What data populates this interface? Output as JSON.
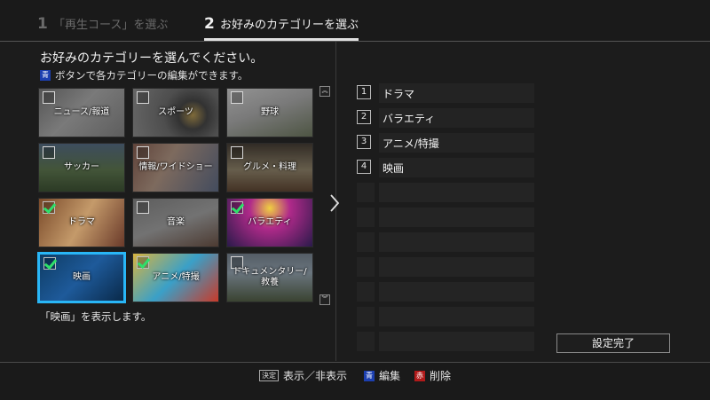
{
  "steps": [
    {
      "num": "1",
      "label": "「再生コース」を選ぶ"
    },
    {
      "num": "2",
      "label": "お好みのカテゴリーを選ぶ"
    }
  ],
  "heading": "お好みのカテゴリーを選んでください。",
  "hint": {
    "key": "青",
    "text": "ボタンで各カテゴリーの編集ができます。"
  },
  "categories": [
    {
      "label": "ニュース/報道",
      "checked": false
    },
    {
      "label": "スポーツ",
      "checked": false
    },
    {
      "label": "野球",
      "checked": false
    },
    {
      "label": "サッカー",
      "checked": false
    },
    {
      "label": "情報/ワイドショー",
      "checked": false
    },
    {
      "label": "グルメ・料理",
      "checked": false
    },
    {
      "label": "ドラマ",
      "checked": true
    },
    {
      "label": "音楽",
      "checked": false
    },
    {
      "label": "バラエティ",
      "checked": true
    },
    {
      "label": "映画",
      "checked": true,
      "focused": true
    },
    {
      "label": "アニメ/特撮",
      "checked": true
    },
    {
      "label": "ドキュメンタリー/教養",
      "checked": false
    }
  ],
  "description": "「映画」を表示します。",
  "selected_slots": [
    {
      "num": "1",
      "label": "ドラマ"
    },
    {
      "num": "2",
      "label": "バラエティ"
    },
    {
      "num": "3",
      "label": "アニメ/特撮"
    },
    {
      "num": "4",
      "label": "映画"
    }
  ],
  "confirm_label": "設定完了",
  "footer": {
    "decide_key": "決定",
    "decide_text": "表示／非表示",
    "blue_key": "青",
    "blue_text": "編集",
    "red_key": "赤",
    "red_text": "削除"
  },
  "colors": {
    "check": "#2ee06a",
    "focus": "#29b6f6",
    "blue_button": "#1c3fb0",
    "red_button": "#b11a1a"
  }
}
